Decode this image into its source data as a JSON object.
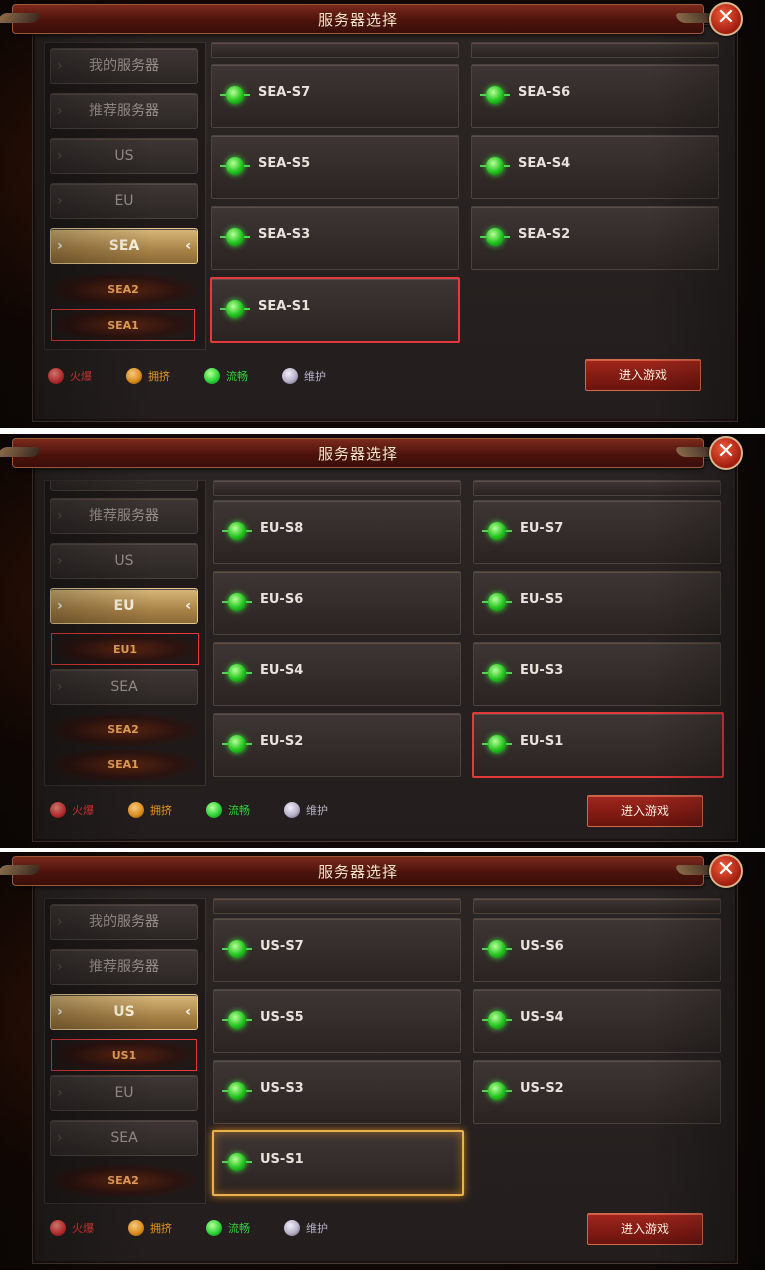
{
  "title": "服务器选择",
  "close_symbol": "✕",
  "enter_label": "进入游戏",
  "legend": [
    {
      "label": "火爆",
      "color": "#e5393b"
    },
    {
      "label": "拥挤",
      "color": "#e7951f"
    },
    {
      "label": "流畅",
      "color": "#2fd43a"
    },
    {
      "label": "维护",
      "color": "#b7b2c8"
    }
  ],
  "panels": [
    {
      "sidebar": {
        "items": [
          "我的服务器",
          "推荐服务器",
          "US",
          "EU",
          "SEA"
        ],
        "active": "SEA",
        "subitems": [
          "SEA2",
          "SEA1"
        ],
        "selected_sub": "SEA1"
      },
      "servers": [
        "SEA-S7",
        "SEA-S6",
        "SEA-S5",
        "SEA-S4",
        "SEA-S3",
        "SEA-S2",
        "SEA-S1"
      ],
      "selected_server": "SEA-S1"
    },
    {
      "sidebar": {
        "items": [
          "推荐服务器",
          "US",
          "EU",
          "SEA"
        ],
        "active": "EU",
        "subitems_after_active": [
          "EU1"
        ],
        "subitems_after_last": [
          "SEA2",
          "SEA1"
        ],
        "selected_sub": "EU1"
      },
      "servers": [
        "EU-S8",
        "EU-S7",
        "EU-S6",
        "EU-S5",
        "EU-S4",
        "EU-S3",
        "EU-S2",
        "EU-S1"
      ],
      "selected_server": "EU-S1"
    },
    {
      "sidebar": {
        "items": [
          "我的服务器",
          "推荐服务器",
          "US",
          "EU",
          "SEA"
        ],
        "active": "US",
        "subitems_after_active": [
          "US1"
        ],
        "subitems_after_last": [
          "SEA2"
        ],
        "selected_sub": "US1"
      },
      "servers": [
        "US-S7",
        "US-S6",
        "US-S5",
        "US-S4",
        "US-S3",
        "US-S2",
        "US-S1"
      ],
      "selected_server": "US-S1"
    }
  ]
}
